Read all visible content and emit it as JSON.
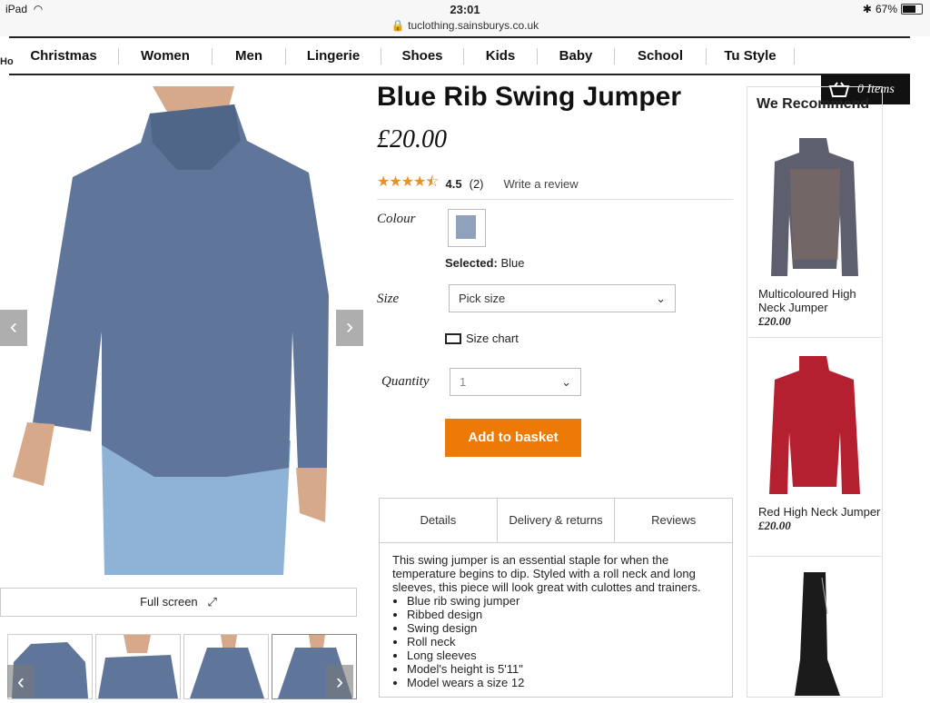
{
  "status": {
    "device": "iPad",
    "time": "23:01",
    "url": "tuclothing.sainsburys.co.uk",
    "battery": "67%"
  },
  "nav": {
    "home_fragment": "Ho",
    "items": [
      "Christmas",
      "Women",
      "Men",
      "Lingerie",
      "Shoes",
      "Kids",
      "Baby",
      "School",
      "Tu Style"
    ]
  },
  "basket": {
    "label": "0 Items"
  },
  "product": {
    "title": "Blue Rib Swing Jumper",
    "price": "£20.00",
    "rating_value": "4.5",
    "rating_count": "(2)",
    "stars": 4.5,
    "write_review": "Write a review",
    "colour_label": "Colour",
    "selected_label": "Selected:",
    "selected_value": "Blue",
    "size_label": "Size",
    "size_value": "Pick size",
    "size_chart": "Size chart",
    "quantity_label": "Quantity",
    "quantity_value": "1",
    "add_to_basket": "Add to basket",
    "full_screen": "Full screen"
  },
  "tabs": [
    {
      "label": "Details"
    },
    {
      "label": "Delivery & returns"
    },
    {
      "label": "Reviews"
    }
  ],
  "details": {
    "description": "This swing jumper is an essential staple for when the temperature begins to dip. Styled with a roll neck and long sleeves, this piece will look great with culottes and trainers.",
    "bullets": [
      "Blue rib swing jumper",
      "Ribbed design",
      "Swing design",
      "Roll neck",
      "Long sleeves",
      "Model's height is 5'11\"",
      "Model wears a size 12"
    ]
  },
  "recommend": {
    "heading": "We Recommend",
    "items": [
      {
        "name": "Multicoloured High Neck Jumper",
        "price": "£20.00"
      },
      {
        "name": "Red High Neck Jumper",
        "price": "£20.00"
      }
    ]
  },
  "colors": {
    "accent": "#ee7a06",
    "star": "#e8902a",
    "jumper": "#5f7599"
  }
}
